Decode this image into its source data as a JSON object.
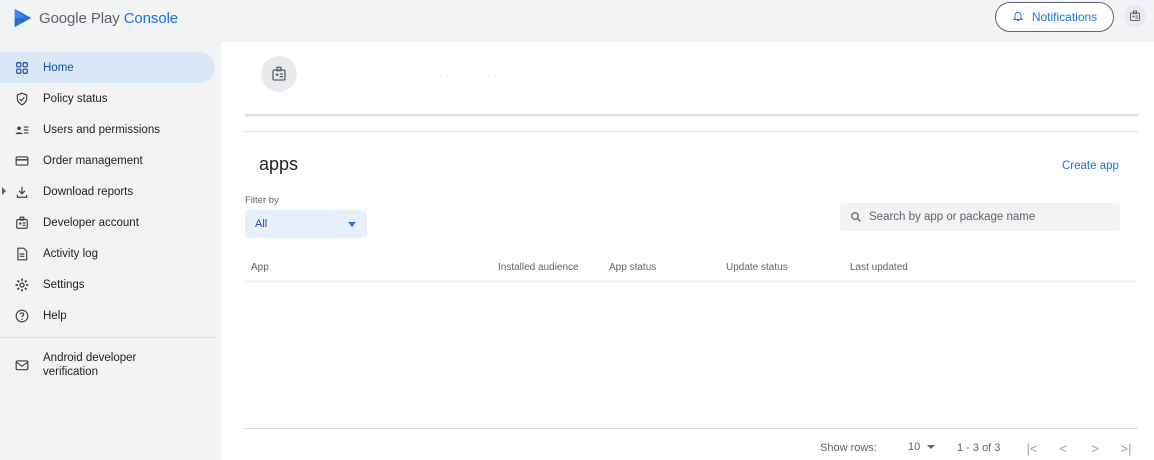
{
  "header": {
    "brand": "Google Play",
    "product": "Console",
    "notifications_label": "Notifications"
  },
  "sidebar": {
    "items": [
      {
        "label": "Home",
        "icon": "home-grid-icon"
      },
      {
        "label": "Policy status",
        "icon": "shield-icon"
      },
      {
        "label": "Users and permissions",
        "icon": "users-list-icon"
      },
      {
        "label": "Order management",
        "icon": "credit-card-icon"
      },
      {
        "label": "Download reports",
        "icon": "download-icon"
      },
      {
        "label": "Developer account",
        "icon": "id-badge-icon"
      },
      {
        "label": "Activity log",
        "icon": "document-icon"
      },
      {
        "label": "Settings",
        "icon": "gear-icon"
      },
      {
        "label": "Help",
        "icon": "help-icon"
      }
    ],
    "extra_line1": "Android developer",
    "extra_line2": "verification"
  },
  "account": {
    "id_text": "·  ·  ·  ·  ·  ·  ·  ·  ·  ·  ·  ·  ·  ·  ·  ·"
  },
  "main": {
    "title": "apps",
    "create_label": "Create app",
    "filter_label": "Filter by",
    "filter_value": "All",
    "search_placeholder": "Search by app or package name"
  },
  "table": {
    "columns": [
      "App",
      "Installed audience",
      "App status",
      "Update status",
      "Last updated"
    ]
  },
  "footer": {
    "show_rows_label": "Show rows:",
    "rows_value": "10",
    "range": "1 - 3 of 3",
    "pager": [
      "|<",
      "<",
      ">",
      ">|"
    ]
  },
  "colors": {
    "accent": "#1a73e8",
    "active_bg": "#dbe6f6",
    "page_bg": "#f1f3f4"
  }
}
